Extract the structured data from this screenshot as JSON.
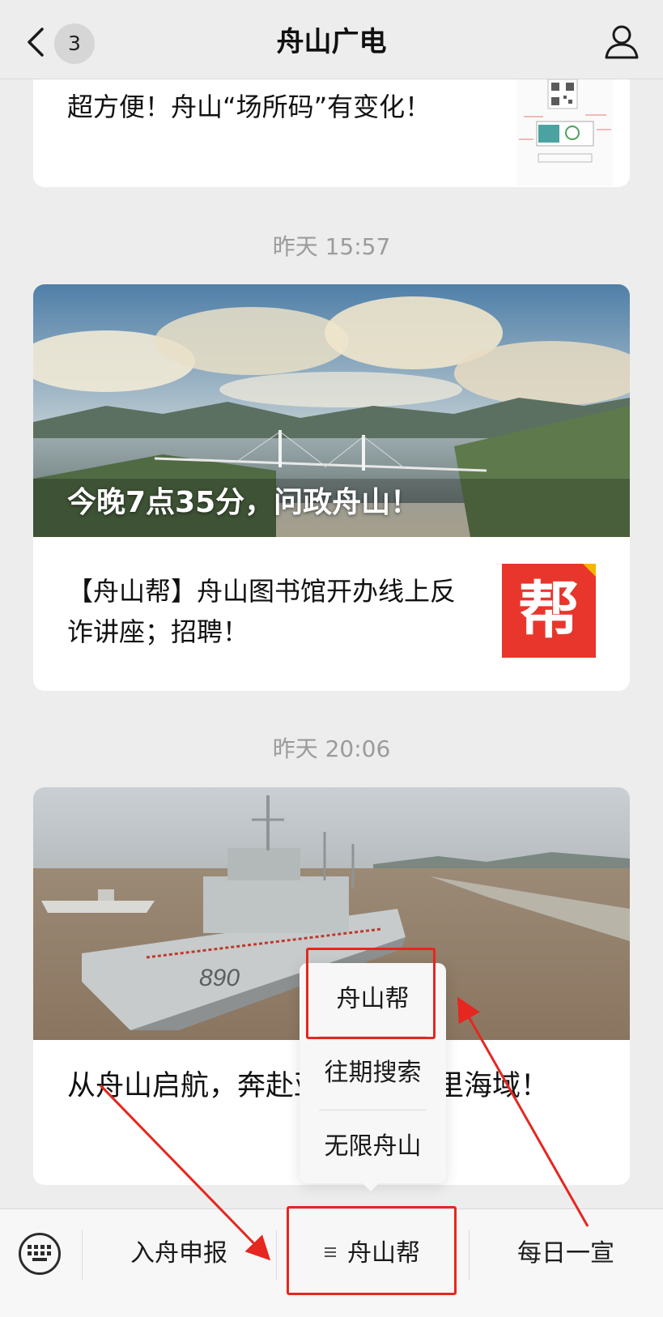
{
  "navbar": {
    "unread_count": "3",
    "title": "舟山广电"
  },
  "feed": {
    "top_article": {
      "title": "超方便！舟山“场所码”有变化！"
    },
    "group1": {
      "timestamp": "昨天 15:57",
      "hero_caption": "今晚7点35分，问政舟山！",
      "sub_article_title": "【舟山帮】舟山图书馆开办线上反诈讲座；招聘！",
      "sub_thumb_text": "帮"
    },
    "group2": {
      "timestamp": "昨天 20:06",
      "hero_title": "从舟山启航，奔赴亚丁湾索马里海域！"
    }
  },
  "popup_menu": {
    "items": [
      "舟山帮",
      "往期搜索",
      "无限舟山"
    ]
  },
  "bottom_menu": {
    "items": [
      "入舟申报",
      "舟山帮",
      "每日一宣"
    ]
  },
  "colors": {
    "background": "#ededed",
    "card": "#ffffff",
    "highlight": "#e5271f",
    "timestamp": "#9b9b9b"
  }
}
